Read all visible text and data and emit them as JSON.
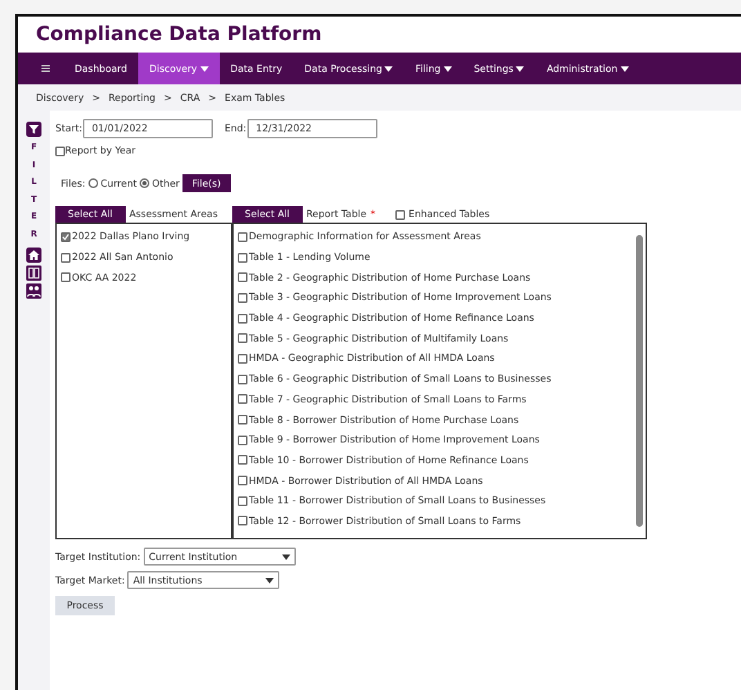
{
  "app_title": "Compliance Data Platform",
  "nav": [
    {
      "label": "Dashboard",
      "selected": false,
      "dropdown": false
    },
    {
      "label": "Discovery",
      "selected": true,
      "dropdown": true
    },
    {
      "label": "Data Entry",
      "selected": false,
      "dropdown": false
    },
    {
      "label": "Data Processing",
      "selected": false,
      "dropdown": true
    },
    {
      "label": "Filing",
      "selected": false,
      "dropdown": true
    },
    {
      "label": "Settings",
      "selected": false,
      "dropdown": true
    },
    {
      "label": "Administration",
      "selected": false,
      "dropdown": true
    }
  ],
  "breadcrumb": [
    "Discovery",
    "Reporting",
    "CRA",
    "Exam Tables"
  ],
  "breadcrumb_separator": ">",
  "filter_label": "FILTER",
  "start": {
    "label": "Start:",
    "value": "01/01/2022"
  },
  "end": {
    "label": "End:",
    "value": "12/31/2022"
  },
  "report_by_year": {
    "label": "Report by Year",
    "checked": false
  },
  "files": {
    "label": "Files:",
    "options": [
      {
        "label": "Current",
        "selected": false
      },
      {
        "label": "Other",
        "selected": true
      }
    ],
    "button": "File(s)"
  },
  "areas": {
    "select_all": "Select All",
    "label": "Assessment Areas",
    "items": [
      {
        "label": "2022 Dallas Plano Irving",
        "checked": true
      },
      {
        "label": "2022 All San Antonio",
        "checked": false
      },
      {
        "label": "OKC AA 2022",
        "checked": false
      }
    ]
  },
  "tables": {
    "select_all": "Select All",
    "label": "Report Table",
    "required_mark": "*",
    "enhanced": {
      "label": "Enhanced Tables",
      "checked": false
    },
    "items": [
      {
        "label": "Demographic Information for Assessment Areas",
        "checked": false
      },
      {
        "label": "Table 1 - Lending Volume",
        "checked": false
      },
      {
        "label": "Table 2 - Geographic Distribution of Home Purchase Loans",
        "checked": false
      },
      {
        "label": "Table 3 - Geographic Distribution of Home Improvement Loans",
        "checked": false
      },
      {
        "label": "Table 4 - Geographic Distribution of Home Refinance Loans",
        "checked": false
      },
      {
        "label": "Table 5 - Geographic Distribution of Multifamily Loans",
        "checked": false
      },
      {
        "label": "HMDA - Geographic Distribution of All HMDA Loans",
        "checked": false
      },
      {
        "label": "Table 6 - Geographic Distribution of Small Loans to Businesses",
        "checked": false
      },
      {
        "label": "Table 7 - Geographic Distribution of Small Loans to Farms",
        "checked": false
      },
      {
        "label": "Table 8 - Borrower Distribution of Home Purchase Loans",
        "checked": false
      },
      {
        "label": "Table 9 - Borrower Distribution of Home Improvement Loans",
        "checked": false
      },
      {
        "label": "Table 10 - Borrower Distribution of Home Refinance Loans",
        "checked": false
      },
      {
        "label": "HMDA - Borrower Distribution of All HMDA Loans",
        "checked": false
      },
      {
        "label": "Table 11 - Borrower Distribution of Small Loans to Businesses",
        "checked": false
      },
      {
        "label": "Table 12 - Borrower Distribution of Small Loans to Farms",
        "checked": false
      }
    ]
  },
  "target_institution": {
    "label": "Target Institution:",
    "value": "Current Institution"
  },
  "target_market": {
    "label": "Target Market:",
    "value": "All Institutions"
  },
  "process_button": "Process"
}
